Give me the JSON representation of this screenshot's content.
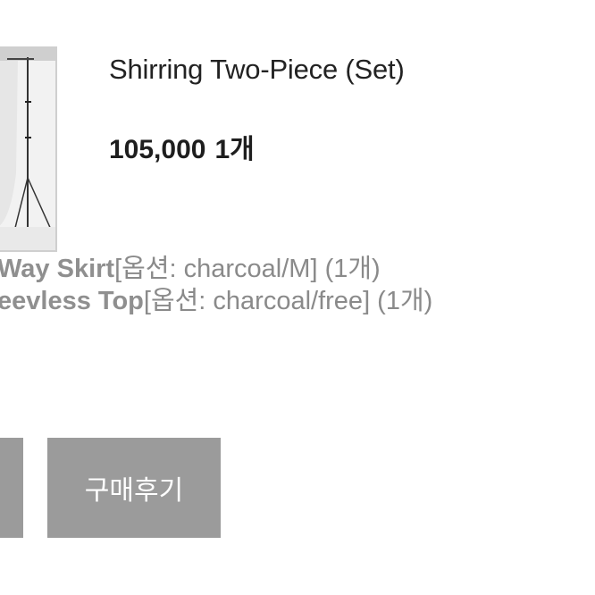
{
  "product": {
    "title": "Shirring Two-Piece (Set)",
    "price": "105,000",
    "quantity": "1개"
  },
  "options": [
    {
      "name": "Way Skirt",
      "detail": "[옵션: charcoal/M] (1개)"
    },
    {
      "name": "eevless Top",
      "detail": "[옵션: charcoal/free] (1개)"
    }
  ],
  "buttons": {
    "review_label": "구매후기",
    "color": "#9b9b9b"
  },
  "icons": {
    "product_image": "product-photo-studio-backdrop"
  }
}
